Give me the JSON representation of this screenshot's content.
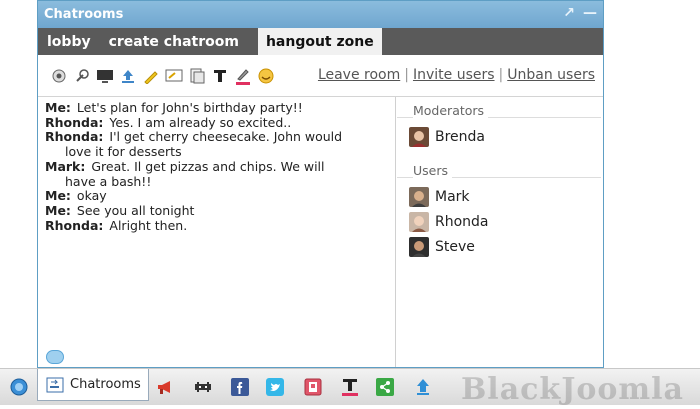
{
  "window": {
    "title": "Chatrooms"
  },
  "tabs": [
    {
      "label": "lobby"
    },
    {
      "label": "create chatroom"
    },
    {
      "label": "hangout zone"
    }
  ],
  "toolbar": {
    "links": [
      "Leave room",
      "Invite users",
      "Unban users"
    ]
  },
  "messages": [
    {
      "who": "Me:",
      "text": "Let's plan for John's birthday party!!",
      "cont": ""
    },
    {
      "who": "Rhonda:",
      "text": "Yes. I am already so excited..",
      "cont": ""
    },
    {
      "who": "Rhonda:",
      "text": "I'l get cherry cheesecake. John would",
      "cont": "love it for desserts"
    },
    {
      "who": "Mark:",
      "text": "Great. Il get pizzas and chips. We will",
      "cont": "have a bash!!"
    },
    {
      "who": "Me:",
      "text": "okay",
      "cont": ""
    },
    {
      "who": "Me:",
      "text": "See you all tonight",
      "cont": ""
    },
    {
      "who": "Rhonda:",
      "text": "Alright then.",
      "cont": ""
    }
  ],
  "moderators": {
    "heading": "Moderators",
    "users": [
      "Brenda"
    ]
  },
  "users": {
    "heading": "Users",
    "list": [
      "Mark",
      "Rhonda",
      "Steve"
    ]
  },
  "dock": {
    "active_label": "Chatrooms"
  },
  "watermark": "BlackJoomla",
  "colors": {
    "titlebar": "#7fb2d6",
    "tabbar": "#5a5a5a",
    "active_tab": "#f1f1f1"
  }
}
